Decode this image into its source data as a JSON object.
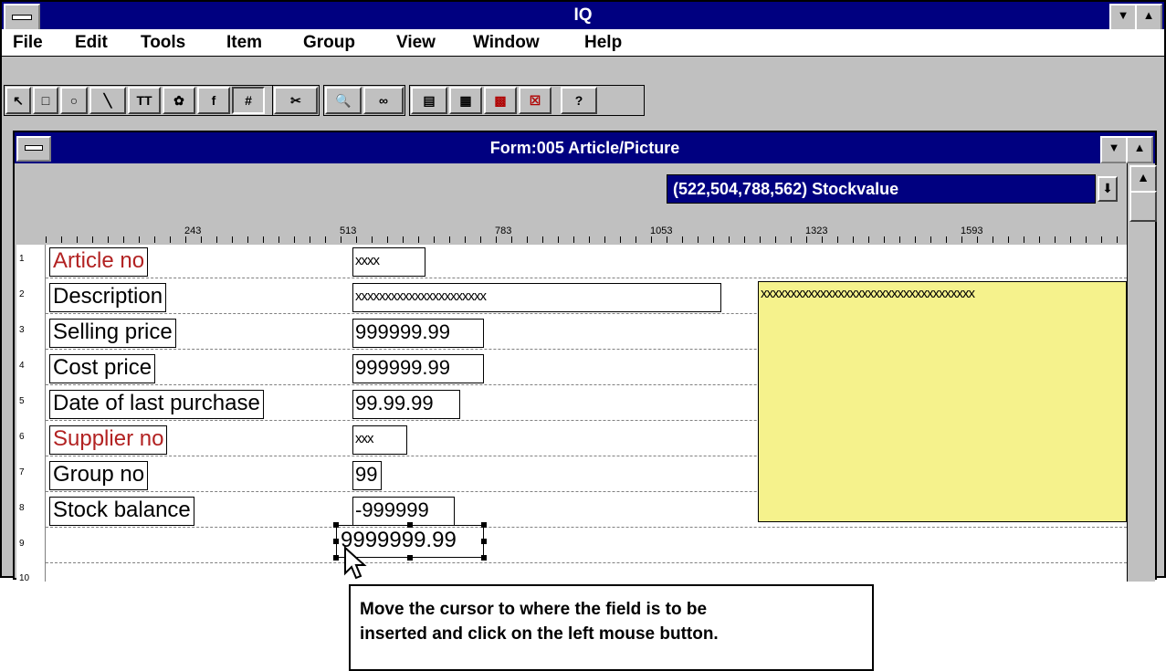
{
  "app": {
    "title": "IQ"
  },
  "menu": [
    "File",
    "Edit",
    "Tools",
    "Item",
    "Group",
    "View",
    "Window",
    "Help"
  ],
  "toolbar": {
    "buttons": [
      {
        "name": "pointer-tool",
        "glyph": "↖"
      },
      {
        "name": "rectangle-tool",
        "glyph": "□"
      },
      {
        "name": "ellipse-tool",
        "glyph": "○"
      },
      {
        "name": "line-tool",
        "glyph": "╲"
      },
      {
        "name": "text-tool",
        "glyph": "TT"
      },
      {
        "name": "picture-tool",
        "glyph": "✿"
      },
      {
        "name": "formula-tool",
        "glyph": "f"
      },
      {
        "name": "field-tool",
        "glyph": "#"
      },
      {
        "name": "cut-tool",
        "glyph": "✂"
      },
      {
        "name": "zoom-tool",
        "glyph": "🔍"
      },
      {
        "name": "glasses-tool",
        "glyph": "∞"
      },
      {
        "name": "layout-tool-1",
        "glyph": "▤"
      },
      {
        "name": "layout-tool-2",
        "glyph": "▦"
      },
      {
        "name": "layout-tool-3",
        "glyph": "▩"
      },
      {
        "name": "delete-tool",
        "glyph": "☒"
      },
      {
        "name": "help-tool",
        "glyph": "?"
      }
    ]
  },
  "form": {
    "title": "Form:005  Article/Picture",
    "selected_field": "(522,504,788,562) Stockvalue",
    "ruler_labels": [
      "243",
      "513",
      "783",
      "1053",
      "1323",
      "1593"
    ],
    "line_numbers": [
      "1",
      "2",
      "3",
      "4",
      "5",
      "6",
      "7",
      "8",
      "9",
      "10"
    ],
    "labels": [
      {
        "text": "Article no",
        "red": true
      },
      {
        "text": "Description",
        "red": false
      },
      {
        "text": "Selling price",
        "red": false
      },
      {
        "text": "Cost price",
        "red": false
      },
      {
        "text": "Date of last purchase",
        "red": false
      },
      {
        "text": "Supplier no",
        "red": true
      },
      {
        "text": "Group no",
        "red": false
      },
      {
        "text": "Stock balance",
        "red": false
      }
    ],
    "fields": [
      "xxxx",
      "xxxxxxxxxxxxxxxxxxxxxx",
      "999999.99",
      "999999.99",
      "99.99.99",
      "xxx",
      "99",
      "-999999"
    ],
    "new_field": "9999999.99",
    "picture_text": "xxxxxxxxxxxxxxxxxxxxxxxxxxxxxxxxxxxx"
  },
  "caption": {
    "line1": "Move the cursor to where the field is to be",
    "line2": "inserted and click on the left mouse button."
  },
  "colors": {
    "titlebar": "#000080",
    "picture": "#f5f28c",
    "red_label": "#b22222"
  }
}
